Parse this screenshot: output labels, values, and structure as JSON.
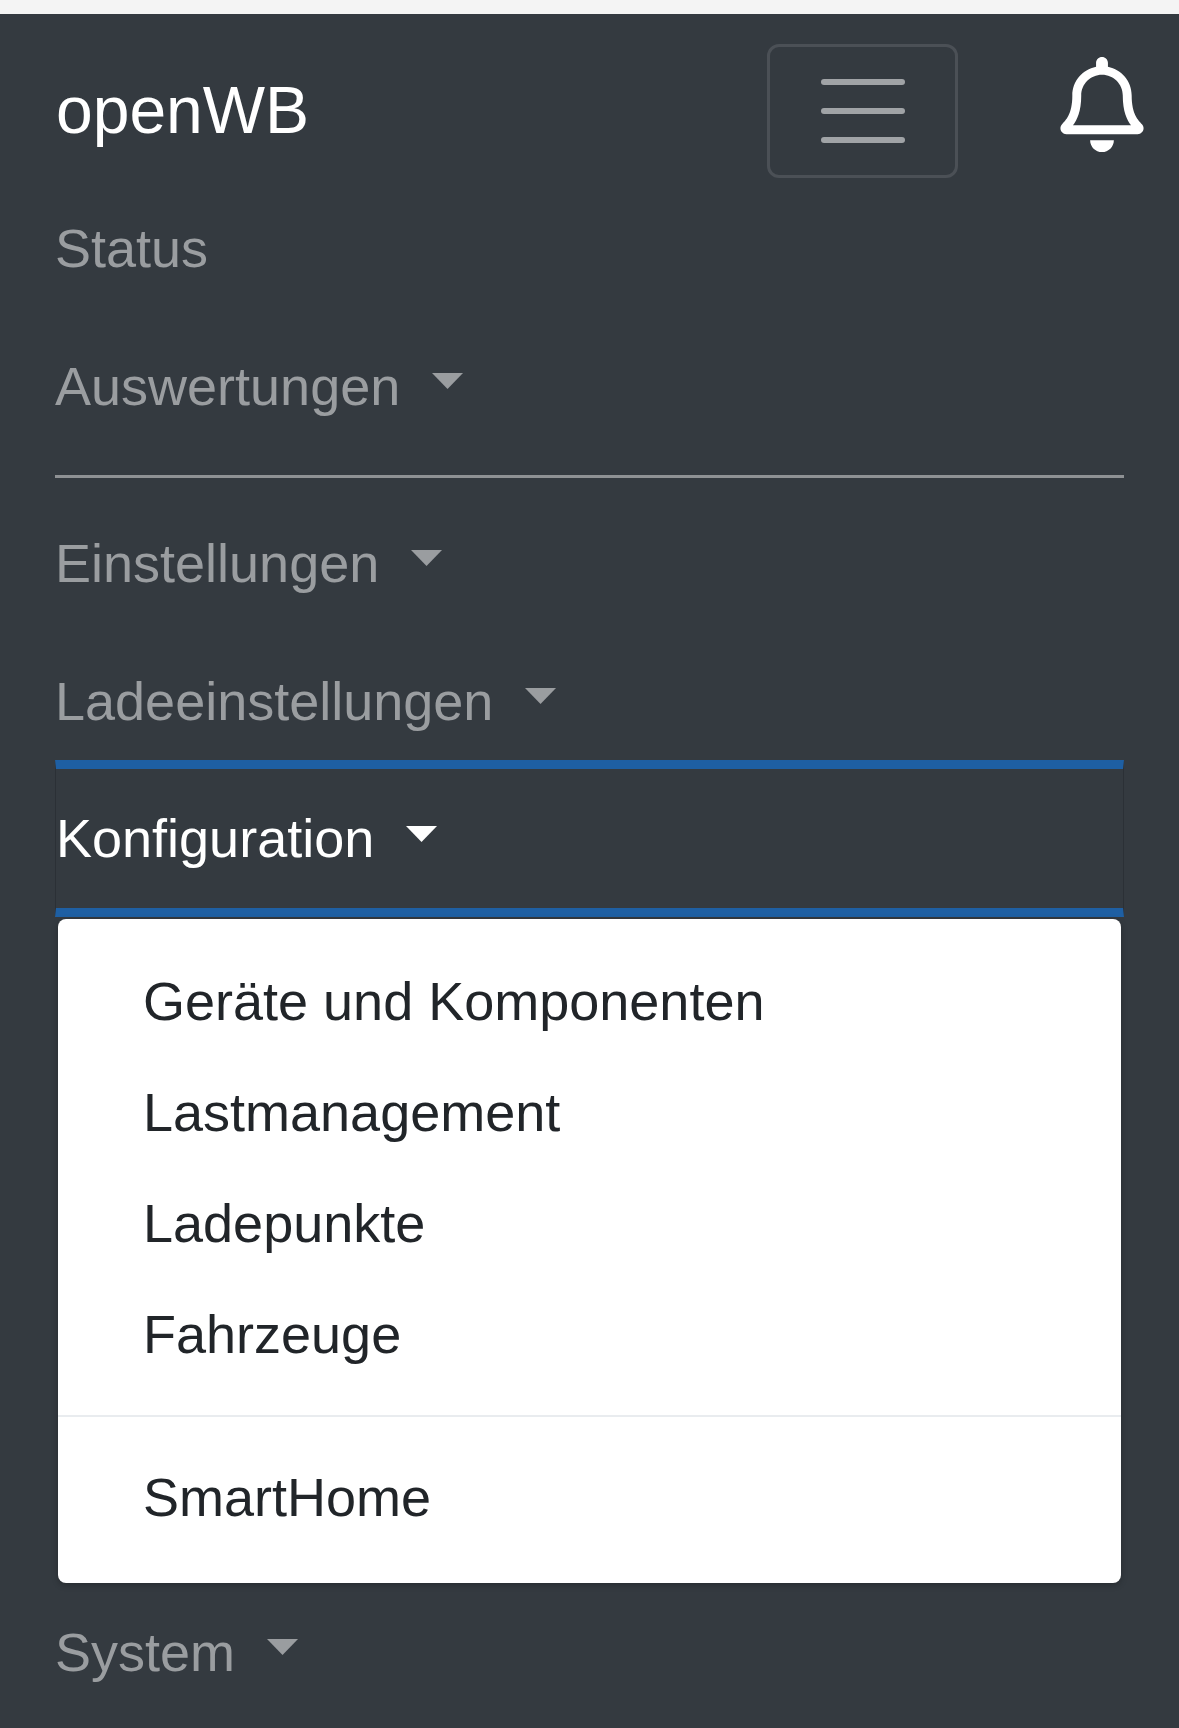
{
  "navbar": {
    "brand": "openWB"
  },
  "nav": [
    {
      "kind": "link",
      "label": "Status",
      "selected": false
    },
    {
      "kind": "dropdown",
      "label": "Auswertungen",
      "selected": false
    },
    {
      "kind": "divider"
    },
    {
      "kind": "dropdown",
      "label": "Einstellungen",
      "selected": false
    },
    {
      "kind": "dropdown",
      "label": "Ladeeinstellungen",
      "selected": false
    },
    {
      "kind": "dropdown",
      "label": "Konfiguration",
      "selected": true,
      "menu": [
        {
          "kind": "item",
          "label": "Geräte und Komponenten"
        },
        {
          "kind": "item",
          "label": "Lastmanagement"
        },
        {
          "kind": "item",
          "label": "Ladepunkte"
        },
        {
          "kind": "item",
          "label": "Fahrzeuge"
        },
        {
          "kind": "divider"
        },
        {
          "kind": "item",
          "label": "SmartHome"
        }
      ]
    },
    {
      "kind": "dropdown",
      "label": "System",
      "selected": false
    }
  ]
}
